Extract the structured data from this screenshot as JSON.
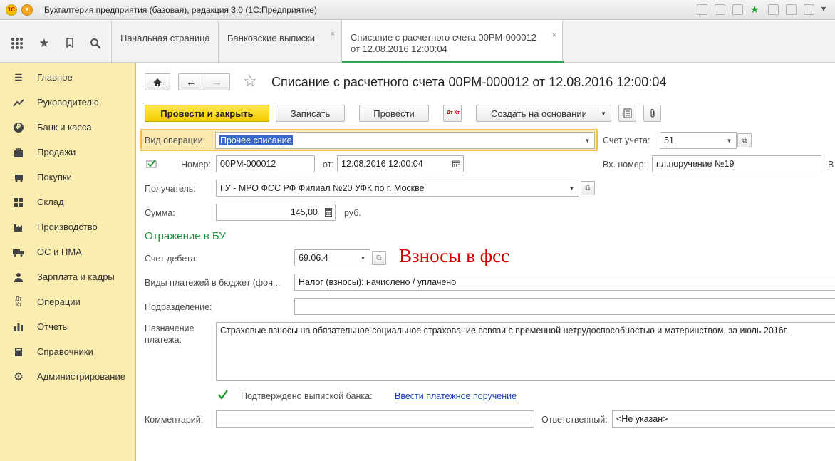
{
  "app": {
    "title": "Бухгалтерия предприятия (базовая), редакция 3.0  (1С:Предприятие)"
  },
  "tabs": [
    {
      "label": "Начальная страница"
    },
    {
      "label": "Банковские выписки"
    },
    {
      "label_line1": "Списание с расчетного счета 00РМ-000012",
      "label_line2": "от 12.08.2016 12:00:04"
    }
  ],
  "sidebar": {
    "items": [
      {
        "label": "Главное",
        "icon": "menu-icon"
      },
      {
        "label": "Руководителю",
        "icon": "trend-icon"
      },
      {
        "label": "Банк и касса",
        "icon": "coin-icon"
      },
      {
        "label": "Продажи",
        "icon": "bag-icon"
      },
      {
        "label": "Покупки",
        "icon": "cart-icon"
      },
      {
        "label": "Склад",
        "icon": "warehouse-icon"
      },
      {
        "label": "Производство",
        "icon": "factory-icon"
      },
      {
        "label": "ОС и НМА",
        "icon": "truck-icon"
      },
      {
        "label": "Зарплата и кадры",
        "icon": "people-icon"
      },
      {
        "label": "Операции",
        "icon": "dt-kt-icon"
      },
      {
        "label": "Отчеты",
        "icon": "chart-icon"
      },
      {
        "label": "Справочники",
        "icon": "book-icon"
      },
      {
        "label": "Администрирование",
        "icon": "gear-icon"
      }
    ]
  },
  "document": {
    "title": "Списание с расчетного счета 00РМ-000012 от 12.08.2016 12:00:04",
    "toolbar": {
      "post_close": "Провести и закрыть",
      "save": "Записать",
      "post": "Провести",
      "create_based": "Создать на основании",
      "dt_kt": "Дт Кт"
    },
    "operation_type_label": "Вид операции:",
    "operation_type_value": "Прочее списание",
    "account_label": "Счет учета:",
    "account_value": "51",
    "number_label": "Номер:",
    "number_value": "00РМ-000012",
    "date_label": "от:",
    "date_value": "12.08.2016 12:00:04",
    "incoming_number_label": "Вх. номер:",
    "incoming_number_value": "пл.поручение №19",
    "cut_letter": "В",
    "recipient_label": "Получатель:",
    "recipient_value": "ГУ - МРО ФСС РФ Филиал №20 УФК по г. Москве",
    "amount_label": "Сумма:",
    "amount_value": "145,00",
    "currency": "руб.",
    "section_title": "Отражение в БУ",
    "debit_account_label": "Счет дебета:",
    "debit_account_value": "69.06.4",
    "annotation": "Взносы в фсс",
    "budget_payment_label": "Виды платежей в бюджет (фон...",
    "budget_payment_value": "Налог (взносы): начислено / уплачено",
    "department_label": "Подразделение:",
    "department_value": "",
    "purpose_label_line1": "Назначение",
    "purpose_label_line2": "платежа:",
    "purpose_value": "Страховые взносы на обязательное социальное страхование всвязи с временной нетрудоспособностью и материнством, за июль 2016г.",
    "confirmed_label": "Подтверждено выпиской банка:",
    "payment_order_link": "Ввести платежное поручение",
    "comment_label": "Комментарий:",
    "comment_value": "",
    "responsible_label": "Ответственный:",
    "responsible_value": "<Не указан>"
  },
  "colors": {
    "sidebar_bg": "#fbedb0",
    "primary_button": "#f5cc00",
    "section_green": "#1a8f3c",
    "annotation_red": "#d40000",
    "selection_blue": "#3867c8"
  }
}
